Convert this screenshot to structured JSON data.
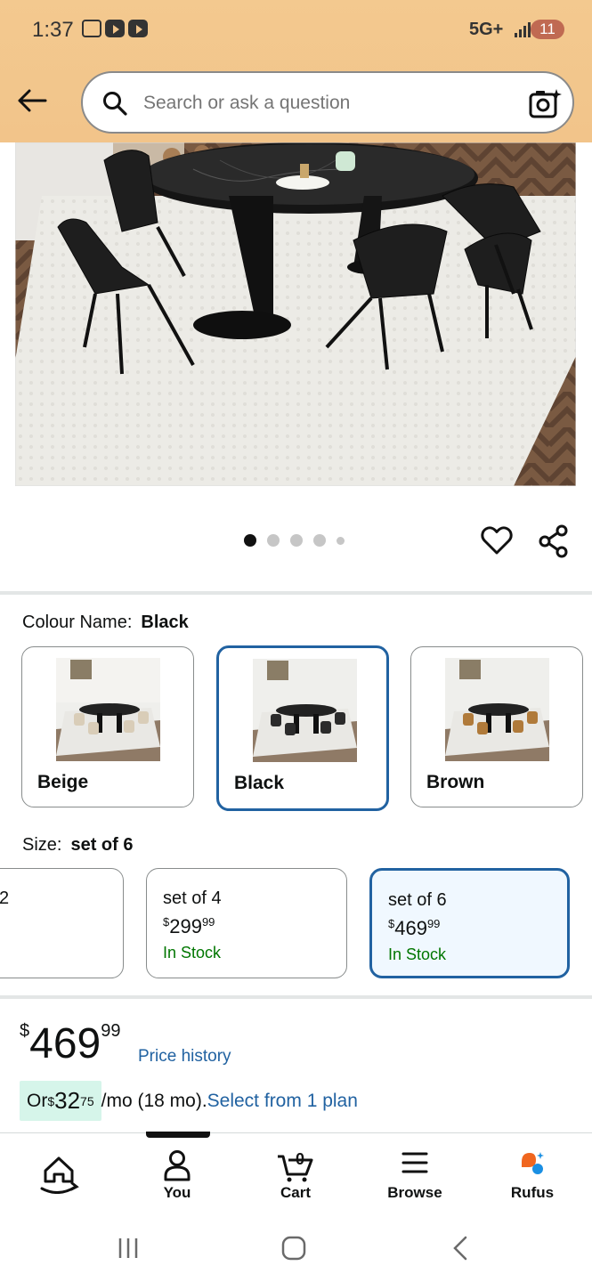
{
  "status_bar": {
    "time": "1:37",
    "network": "5G+",
    "battery": "11"
  },
  "search": {
    "placeholder": "Search or ask a question"
  },
  "carousel": {
    "total_dots": 5,
    "active_index": 0
  },
  "colour": {
    "label": "Colour Name:",
    "selected": "Black",
    "options": [
      {
        "name": "Beige",
        "chair_color": "#d9cdb8"
      },
      {
        "name": "Black",
        "chair_color": "#2b2b2b"
      },
      {
        "name": "Brown",
        "chair_color": "#b07a3a"
      }
    ]
  },
  "size": {
    "label": "Size:",
    "selected": "set of 6",
    "options": [
      {
        "title": "2",
        "price_symbol": "",
        "price_whole": "",
        "price_cents": "",
        "stock": ""
      },
      {
        "title": "set of 4",
        "price_symbol": "$",
        "price_whole": "299",
        "price_cents": "99",
        "stock": "In Stock"
      },
      {
        "title": "set of 6",
        "price_symbol": "$",
        "price_whole": "469",
        "price_cents": "99",
        "stock": "In Stock"
      }
    ]
  },
  "price": {
    "symbol": "$",
    "whole": "469",
    "cents": "99",
    "history_link": "Price history"
  },
  "installment": {
    "prefix": "Or ",
    "symbol": "$",
    "whole": "32",
    "cents": "75",
    "suffix": "/mo (18 mo).",
    "link": "Select from 1 plan"
  },
  "bottom_nav": {
    "items": [
      {
        "label": "",
        "icon": "home-icon"
      },
      {
        "label": "You",
        "icon": "person-icon"
      },
      {
        "label": "Cart",
        "icon": "cart-icon",
        "count": "0"
      },
      {
        "label": "Browse",
        "icon": "menu-icon"
      },
      {
        "label": "Rufus",
        "icon": "rufus-icon"
      }
    ]
  },
  "colors": {
    "accent": "#2162a1",
    "stock_green": "#007600",
    "header_bg": "#f2c48a",
    "installment_bg": "#d6f5ea"
  }
}
